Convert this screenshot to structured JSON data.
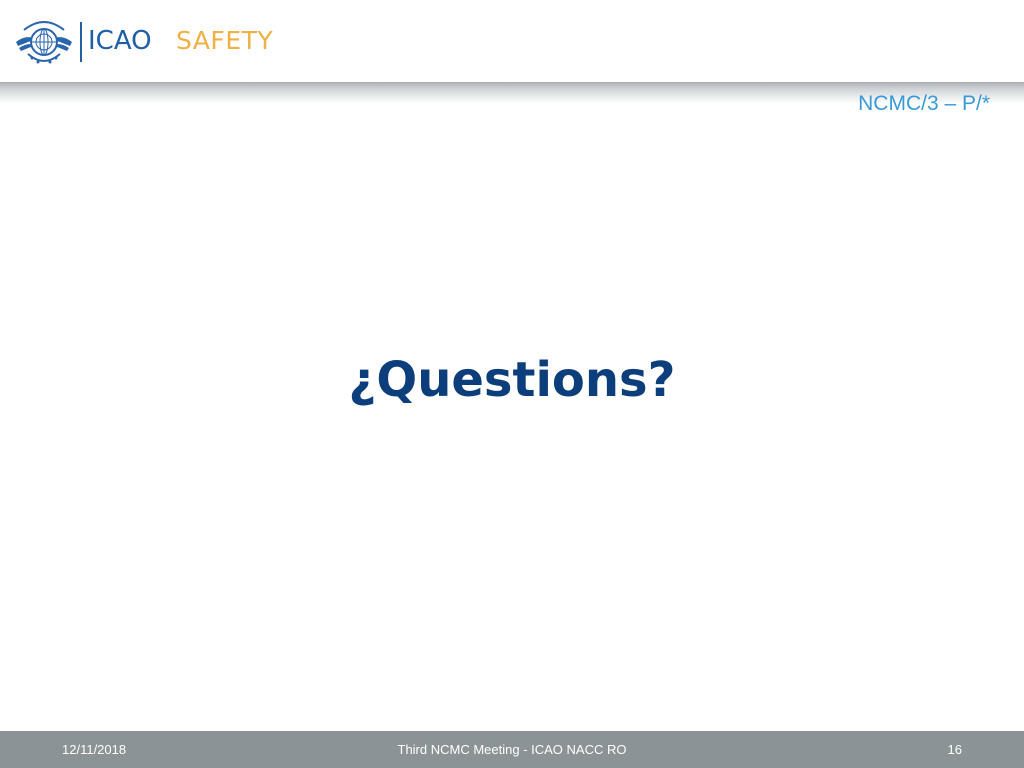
{
  "header": {
    "logo_text": "ICAO",
    "tagline": "SAFETY",
    "emblem_icon": "un-emblem-icon",
    "colors": {
      "logo_blue": "#1f5fa8",
      "safety_gold": "#f0b043"
    }
  },
  "slide": {
    "reference": "NCMC/3 – P/*",
    "title": "¿Questions?",
    "title_color": "#0d3e7c"
  },
  "footer": {
    "date": "12/11/2018",
    "meeting": "Third NCMC Meeting - ICAO NACC RO",
    "page_number": "16",
    "background": "#8c9397"
  }
}
